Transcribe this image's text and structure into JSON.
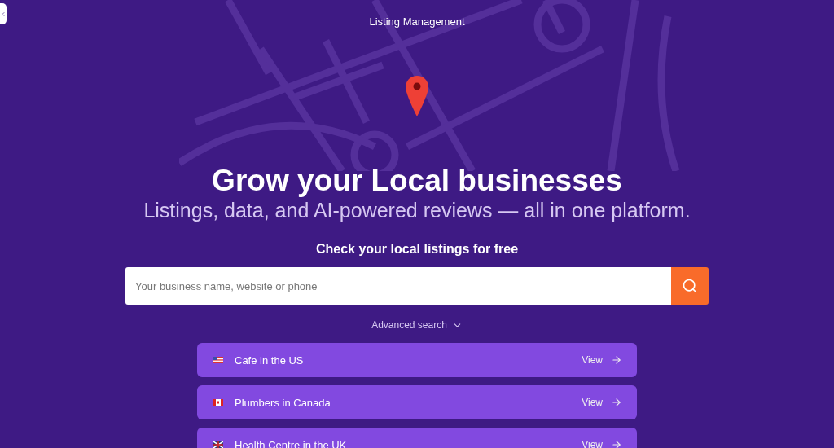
{
  "header": {
    "title": "Listing Management"
  },
  "hero": {
    "title": "Grow your Local businesses",
    "subtitle": "Listings, data, and AI-powered reviews — all in one platform."
  },
  "search": {
    "label": "Check your local listings for free",
    "placeholder": "Your business name, website or phone",
    "advanced": "Advanced search"
  },
  "examples": [
    {
      "label": "Cafe in the US",
      "action": "View",
      "kind": "us"
    },
    {
      "label": "Plumbers in Canada",
      "action": "View",
      "kind": "ca"
    },
    {
      "label": "Health Centre in the UK",
      "action": "View",
      "kind": "uk"
    }
  ]
}
